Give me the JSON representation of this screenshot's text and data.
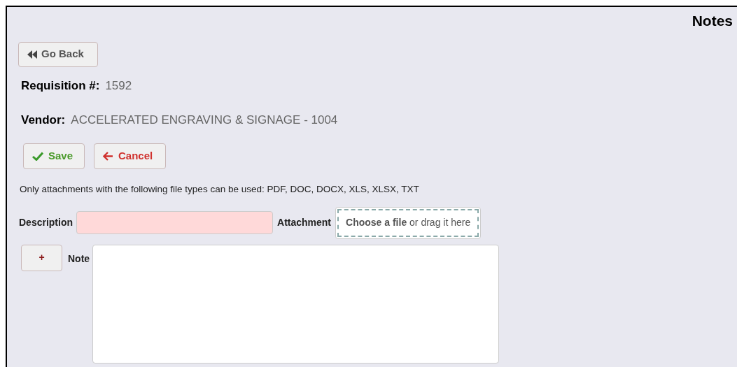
{
  "header": {
    "title": "Notes"
  },
  "back_button": {
    "label": "Go Back"
  },
  "fields": [
    {
      "label": "Requisition #:",
      "value": "1592"
    },
    {
      "label": "Vendor:",
      "value": "ACCELERATED ENGRAVING & SIGNAGE - 1004"
    }
  ],
  "actions": [
    {
      "kind": "save",
      "label": "Save"
    },
    {
      "kind": "cancel",
      "label": "Cancel"
    }
  ],
  "file_types_note": "Only attachments with the following file types can be used: PDF, DOC, DOCX, XLS, XLSX, TXT",
  "description": {
    "label": "Description",
    "invalid": true
  },
  "attachment": {
    "label": "Attachment",
    "dropzone": "**Choose a file** or drag it here"
  },
  "add_button": {
    "label": "+"
  },
  "note": {
    "label": "Note"
  }
}
